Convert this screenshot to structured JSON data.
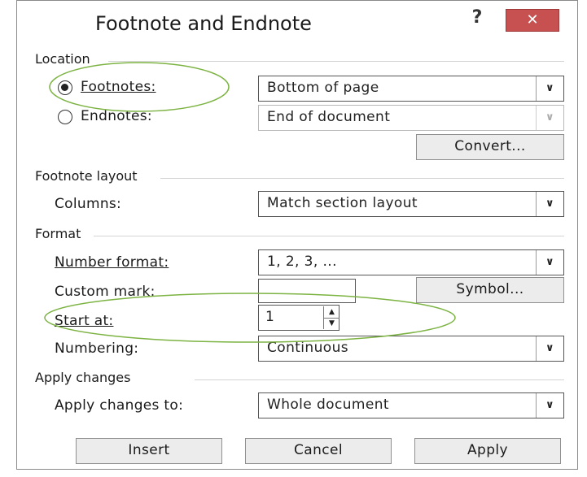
{
  "dialog": {
    "title": "Footnote and Endnote",
    "help_label": "?",
    "close_label": "✕"
  },
  "location": {
    "section_label": "Location",
    "footnotes": {
      "label": "Footnotes:",
      "selected": true,
      "value": "Bottom of page"
    },
    "endnotes": {
      "label": "Endnotes:",
      "selected": false,
      "value": "End of document"
    },
    "convert_label": "Convert..."
  },
  "layout": {
    "section_label": "Footnote layout",
    "columns_label": "Columns:",
    "columns_value": "Match section layout"
  },
  "format": {
    "section_label": "Format",
    "number_format_label": "Number format:",
    "number_format_value": "1, 2, 3, ...",
    "custom_mark_label": "Custom mark:",
    "custom_mark_value": "",
    "symbol_label": "Symbol...",
    "start_at_label": "Start at:",
    "start_at_value": "1",
    "numbering_label": "Numbering:",
    "numbering_value": "Continuous"
  },
  "apply_changes": {
    "section_label": "Apply changes",
    "apply_to_label": "Apply changes to:",
    "apply_to_value": "Whole document"
  },
  "buttons": {
    "insert": "Insert",
    "cancel": "Cancel",
    "apply": "Apply"
  },
  "annotation_color": "#7cb342"
}
